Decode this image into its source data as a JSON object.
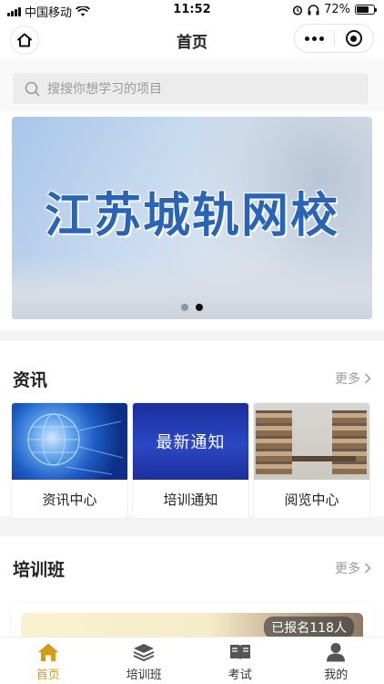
{
  "status_bar": {
    "carrier": "中国移动",
    "time": "11:52",
    "battery_percent": "72%",
    "battery_level": 0.72
  },
  "nav": {
    "title": "首页"
  },
  "search": {
    "placeholder": "搜搜你想学习的项目"
  },
  "banner": {
    "title": "江苏城轨网校",
    "slide_count": 2,
    "active_slide": 2
  },
  "news": {
    "title": "资讯",
    "more_label": "更多",
    "cards": [
      {
        "label": "资讯中心"
      },
      {
        "label": "培训通知",
        "thumb_text": "最新通知"
      },
      {
        "label": "阅览中心"
      }
    ]
  },
  "training": {
    "title": "培训班",
    "more_label": "更多",
    "enrolled_badge": "已报名118人"
  },
  "tab_bar": {
    "items": [
      {
        "label": "首页",
        "icon": "home-icon",
        "active": true
      },
      {
        "label": "培训班",
        "icon": "layers-icon",
        "active": false
      },
      {
        "label": "考试",
        "icon": "book-icon",
        "active": false
      },
      {
        "label": "我的",
        "icon": "person-icon",
        "active": false
      }
    ]
  },
  "colors": {
    "accent": "#d59a17",
    "banner_text": "#2a64b6"
  }
}
